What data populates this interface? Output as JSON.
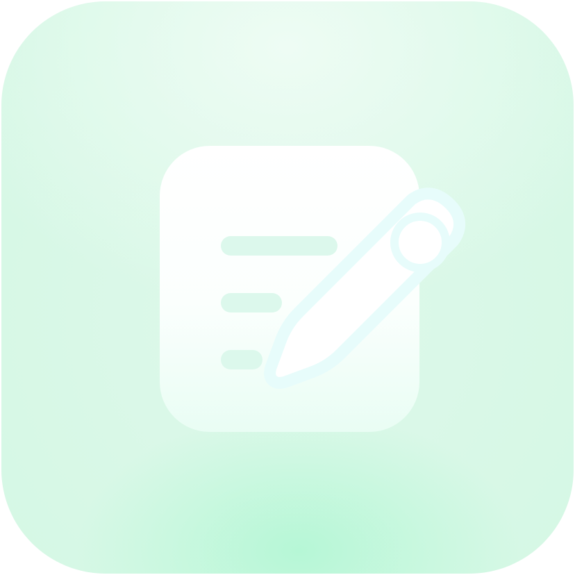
{
  "icon": {
    "name": "notes-edit-icon",
    "colors": {
      "background_light": "#eefcf4",
      "background_mid": "#d7f8e6",
      "background_glow": "#b6f7d6",
      "document": "#ffffff",
      "document_bottom": "#e9fdf4",
      "pencil_outline": "#e7fcfb",
      "pencil_fill": "#ffffff"
    }
  }
}
